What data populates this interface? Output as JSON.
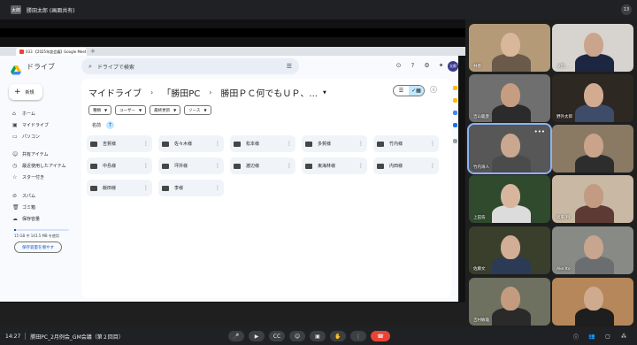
{
  "presenter": {
    "avatar_text": "太郎",
    "name": "勝田太郎 (画面共有)",
    "count": "13"
  },
  "browser": {
    "tab_title": "033 【2025年度会議】Google Meet",
    "new_tab": "+"
  },
  "drive": {
    "app_name": "ドライブ",
    "search_placeholder": "ドライブで検索",
    "avatar_text": "太郎",
    "new_button": "新規",
    "nav": [
      {
        "icon": "home-icon",
        "glyph": "⌂",
        "label": "ホーム"
      },
      {
        "icon": "my-drive-icon",
        "glyph": "▣",
        "label": "マイドライブ"
      },
      {
        "icon": "computer-icon",
        "glyph": "▭",
        "label": "パソコン"
      },
      {
        "icon": "shared-icon",
        "glyph": "☺",
        "label": "共有アイテム"
      },
      {
        "icon": "recent-icon",
        "glyph": "◷",
        "label": "最近使用したアイテム"
      },
      {
        "icon": "star-icon",
        "glyph": "☆",
        "label": "スター付き"
      },
      {
        "icon": "spam-icon",
        "glyph": "⊘",
        "label": "スパム"
      },
      {
        "icon": "trash-icon",
        "glyph": "🗑",
        "label": "ゴミ箱"
      },
      {
        "icon": "storage-icon",
        "glyph": "☁",
        "label": "保存容量"
      }
    ],
    "storage_text": "15 GB 中 143.5 MB を使用",
    "storage_fraction": 0.01,
    "storage_button": "保存容量を増やす",
    "breadcrumbs": [
      "マイドライブ",
      "「勝田PC",
      "勝田ＰＣ何でもＵＰ、..."
    ],
    "chips": [
      "種類",
      "ユーザー",
      "最終更新",
      "ソース"
    ],
    "sort_label": "名前",
    "folders": [
      "吉賀様",
      "佐々木様",
      "松本様",
      "多賀様",
      "竹内様",
      "中島様",
      "坪井様",
      "渡辺様",
      "東海林様",
      "内田様",
      "飯田様",
      "李様"
    ]
  },
  "participants": [
    {
      "name": "林恵",
      "bg": "#b59a78",
      "skin": "#d9b79a",
      "shirt": "#6a5a4a"
    },
    {
      "name": "ユ田 ...",
      "bg": "#d7d3cf",
      "skin": "#caa58c",
      "shirt": "#1d2640"
    },
    {
      "name": "吉山聡彦",
      "bg": "#6f6f6f",
      "skin": "#c79d82",
      "shirt": "#2b2b2b"
    },
    {
      "name": "野外太郎",
      "bg": "#2e2822",
      "skin": "#d3ab91",
      "shirt": "#3e4c6a"
    },
    {
      "name": "竹内海人",
      "bg": "#575757",
      "skin": "#c9a88f",
      "shirt": "#4b4b4b"
    },
    {
      "name": "",
      "bg": "#8a7a64",
      "skin": "#c9a48a",
      "shirt": "#2d2d2d"
    },
    {
      "name": "上田浩",
      "bg": "#2f4a2c",
      "skin": "#d8b69d",
      "shirt": "#dcdcdc"
    },
    {
      "name": "坂東 利",
      "bg": "#c8b8a4",
      "skin": "#c29b82",
      "shirt": "#5d3b34"
    },
    {
      "name": "佐藤文",
      "bg": "#3a3f2c",
      "skin": "#d1ae95",
      "shirt": "#2b3a55"
    },
    {
      "name": "Ake Ito",
      "bg": "#888a86",
      "skin": "#c7a58e",
      "shirt": "#6a6e70"
    },
    {
      "name": "吉村敏雄",
      "bg": "#6e7060",
      "skin": "#c39c80",
      "shirt": "#2a2a2a"
    },
    {
      "name": "",
      "bg": "#b5875a",
      "skin": "#d0aa8f",
      "shirt": "#1e1e1e"
    }
  ],
  "bottom_bar": {
    "time": "14:27",
    "meeting_name": "勝田PC_2月例会_GM会議（第２回目）"
  }
}
